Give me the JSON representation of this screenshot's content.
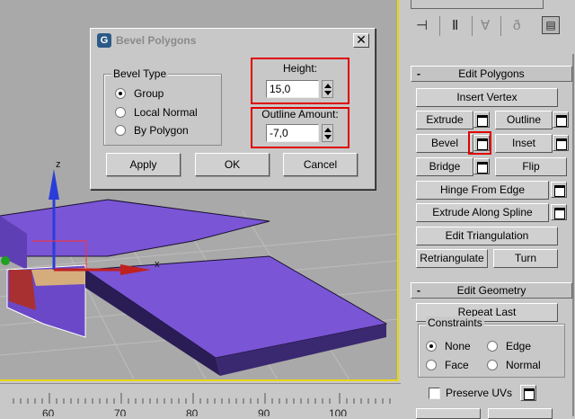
{
  "dialog": {
    "title": "Bevel Polygons",
    "close_symbol": "✕",
    "bevel_type_label": "Bevel Type",
    "options": [
      "Group",
      "Local Normal",
      "By Polygon"
    ],
    "selected_option": "Group",
    "height_label": "Height:",
    "height_value": "15,0",
    "outline_label": "Outline Amount:",
    "outline_value": "-7,0",
    "apply_label": "Apply",
    "ok_label": "OK",
    "cancel_label": "Cancel"
  },
  "panel": {
    "edit_polygons": {
      "title": "Edit Polygons",
      "insert_vertex": "Insert Vertex",
      "extrude": "Extrude",
      "outline": "Outline",
      "bevel": "Bevel",
      "inset": "Inset",
      "bridge": "Bridge",
      "flip": "Flip",
      "hinge_from_edge": "Hinge From Edge",
      "extrude_along_spline": "Extrude Along Spline",
      "edit_triangulation": "Edit Triangulation",
      "retriangulate": "Retriangulate",
      "turn": "Turn"
    },
    "edit_geometry": {
      "title": "Edit Geometry",
      "repeat_last": "Repeat Last",
      "constraints_label": "Constraints",
      "constraint_options": [
        "None",
        "Edge",
        "Face",
        "Normal"
      ],
      "selected_constraint": "None",
      "preserve_uvs": "Preserve UVs"
    },
    "rollout_symbol": "-"
  },
  "viewport": {
    "axis_z": "z",
    "axis_x": "x"
  },
  "ruler": {
    "labels": [
      "60",
      "70",
      "80",
      "90",
      "100"
    ]
  },
  "colors": {
    "object_purple": "#7a55d6",
    "highlight_red": "#e00000",
    "viewport_border": "#e8d800"
  }
}
